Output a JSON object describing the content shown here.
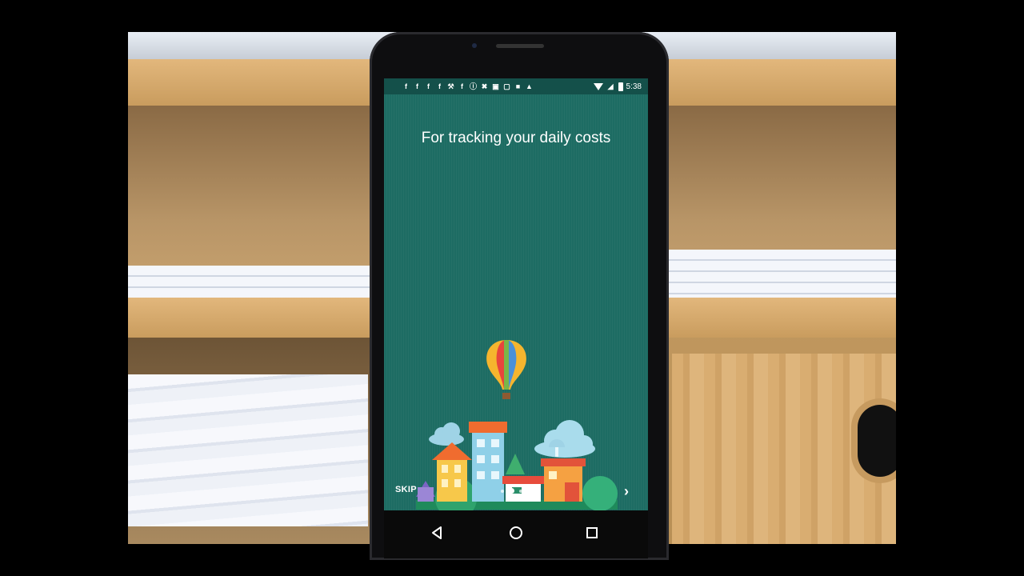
{
  "status_bar": {
    "time": "5:38",
    "notification_icons": [
      "facebook-icon",
      "facebook-icon",
      "facebook-icon",
      "facebook-icon",
      "wrench-icon",
      "facebook-icon",
      "info-icon",
      "tools-icon",
      "lock-icon",
      "messenger-icon",
      "camera-icon",
      "android-icon"
    ],
    "icon_glyphs": [
      "f",
      "f",
      "f",
      "f",
      "⚒",
      "f",
      "ⓘ",
      "✖",
      "▣",
      "▢",
      "■",
      "▲"
    ]
  },
  "onboarding": {
    "headline": "For tracking your daily costs",
    "skip_label": "SKIP",
    "next_icon": "chevron-right-icon",
    "next_glyph": "›",
    "page_count": 3,
    "active_page": 2
  },
  "nav_bar": {
    "back": "back-icon",
    "home": "home-icon",
    "recents": "recents-icon"
  },
  "colors": {
    "screen_bg": "#1d6c63",
    "status_bar_bg": "#14504a"
  }
}
